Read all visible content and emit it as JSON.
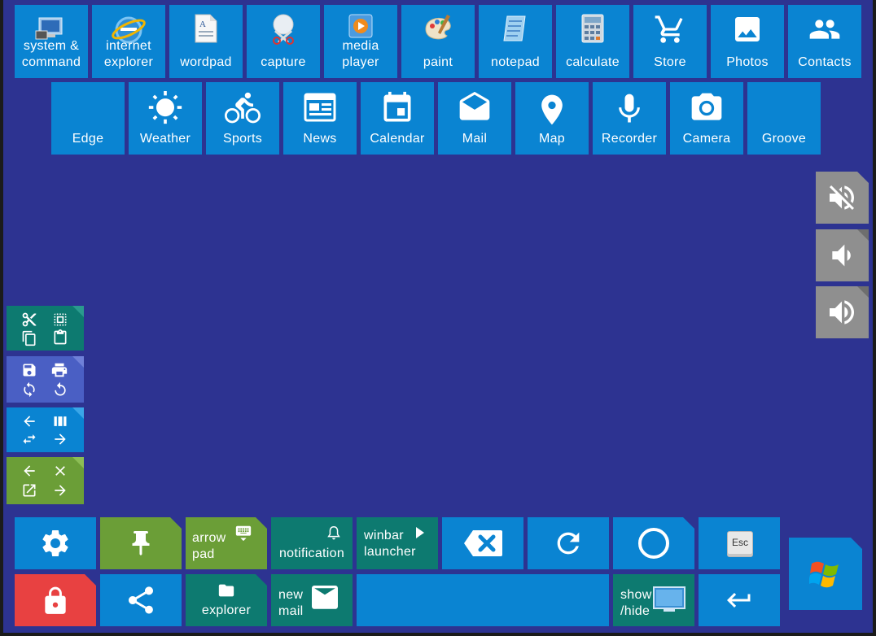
{
  "top_row": [
    {
      "label": "system &\ncommand",
      "icon": "system-command-icon"
    },
    {
      "label": "internet\nexplorer",
      "icon": "internet-explorer-icon"
    },
    {
      "label": "wordpad",
      "icon": "wordpad-icon"
    },
    {
      "label": "capture",
      "icon": "capture-icon"
    },
    {
      "label": "media\nplayer",
      "icon": "media-player-icon"
    },
    {
      "label": "paint",
      "icon": "paint-icon"
    },
    {
      "label": "notepad",
      "icon": "notepad-icon"
    },
    {
      "label": "calculate",
      "icon": "calculator-icon"
    },
    {
      "label": "Store",
      "icon": "cart-icon"
    },
    {
      "label": "Photos",
      "icon": "photo-icon"
    },
    {
      "label": "Contacts",
      "icon": "contacts-icon"
    }
  ],
  "second_row": [
    {
      "label": "Edge"
    },
    {
      "label": "Weather",
      "icon": "sun-icon"
    },
    {
      "label": "Sports",
      "icon": "bicycle-icon"
    },
    {
      "label": "News",
      "icon": "news-icon"
    },
    {
      "label": "Calendar",
      "icon": "calendar-icon"
    },
    {
      "label": "Mail",
      "icon": "mail-icon"
    },
    {
      "label": "Map",
      "icon": "map-pin-icon"
    },
    {
      "label": "Recorder",
      "icon": "microphone-icon"
    },
    {
      "label": "Camera",
      "icon": "camera-icon"
    },
    {
      "label": "Groove"
    }
  ],
  "volume": [
    "mute-icon",
    "volume-down-icon",
    "volume-up-icon"
  ],
  "bottom": {
    "arrow_pad": "arrow\npad",
    "notification": "notification",
    "winbar": "winbar\nlauncher",
    "explorer": "explorer",
    "new_mail": "new\nmail",
    "show_hide": "show\n/hide",
    "esc": "Esc"
  },
  "colors": {
    "background": "#2d3391",
    "tile_blue": "#0a84d2",
    "tile_teal": "#0d7a70",
    "tile_green": "#6b9e37",
    "tile_purple": "#4a5fc4",
    "tile_red": "#e84141",
    "tile_gray": "#8f8f8f"
  }
}
